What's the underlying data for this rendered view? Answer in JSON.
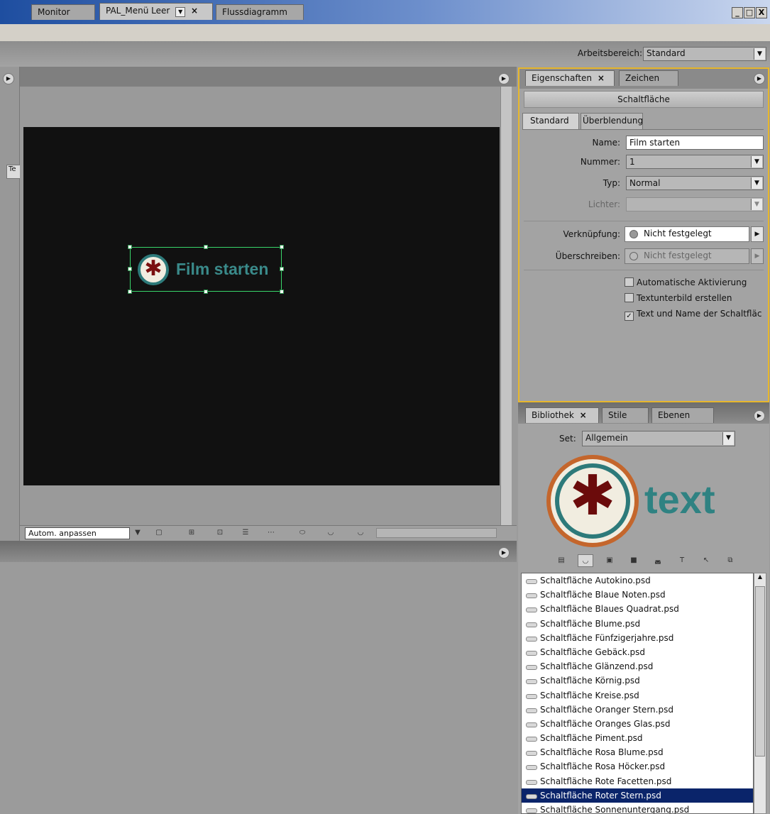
{
  "window": {
    "controls": [
      "_",
      "□",
      "X"
    ]
  },
  "workspace": {
    "label": "Arbeitsbereich:",
    "value": "Standard"
  },
  "monitor": {
    "tabs": [
      {
        "label": "Monitor"
      },
      {
        "label": "PAL_Menü Leer"
      },
      {
        "label": "Flussdiagramm"
      }
    ],
    "left_tab_label": "Te",
    "button_label": "Film starten",
    "zoom_value": "Autom. anpassen"
  },
  "properties": {
    "tabs": [
      {
        "label": "Eigenschaften"
      },
      {
        "label": "Zeichen"
      }
    ],
    "title": "Schaltfläche",
    "subtabs": [
      {
        "label": "Standard"
      },
      {
        "label": "Überblendung"
      }
    ],
    "name_label": "Name:",
    "name_value": "Film starten",
    "nummer_label": "Nummer:",
    "nummer_value": "1",
    "typ_label": "Typ:",
    "typ_value": "Normal",
    "lichter_label": "Lichter:",
    "lichter_value": "",
    "verknuepfung_label": "Verknüpfung:",
    "verknuepfung_value": "Nicht festgelegt",
    "ueberschreiben_label": "Überschreiben:",
    "ueberschreiben_value": "Nicht festgelegt",
    "checkboxes": [
      {
        "label": "Automatische Aktivierung",
        "checked": false
      },
      {
        "label": "Textunterbild erstellen",
        "checked": false
      },
      {
        "label": "Text und Name der Schaltfläc",
        "checked": true
      }
    ]
  },
  "library": {
    "tabs": [
      {
        "label": "Bibliothek"
      },
      {
        "label": "Stile"
      },
      {
        "label": "Ebenen"
      }
    ],
    "set_label": "Set:",
    "set_value": "Allgemein",
    "preview_text": "text",
    "items": [
      "Schaltfläche Autokino.psd",
      "Schaltfläche Blaue Noten.psd",
      "Schaltfläche Blaues Quadrat.psd",
      "Schaltfläche Blume.psd",
      "Schaltfläche Fünfzigerjahre.psd",
      "Schaltfläche Gebäck.psd",
      "Schaltfläche Glänzend.psd",
      "Schaltfläche Körnig.psd",
      "Schaltfläche Kreise.psd",
      "Schaltfläche Oranger Stern.psd",
      "Schaltfläche Oranges Glas.psd",
      "Schaltfläche Piment.psd",
      "Schaltfläche Rosa Blume.psd",
      "Schaltfläche Rosa Höcker.psd",
      "Schaltfläche Rote Facetten.psd",
      "Schaltfläche Roter Stern.psd",
      "Schaltfläche Sonnenuntergang.psd"
    ],
    "selected_index": 15
  },
  "colors": {
    "accent": "#e7b72c",
    "selection": "#0a246a",
    "canvas": "#111111",
    "brand_teal": "#2f8282"
  }
}
